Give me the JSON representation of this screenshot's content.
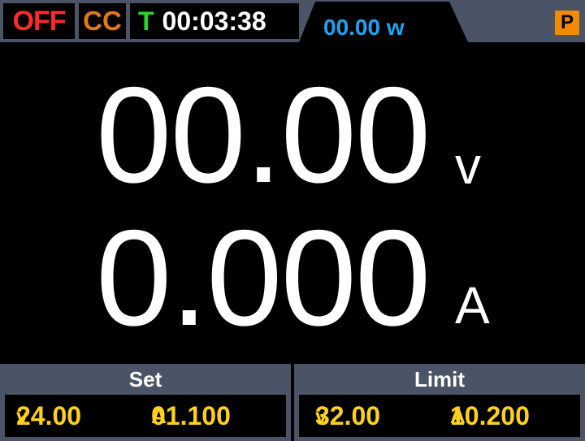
{
  "status": {
    "output": "OFF",
    "mode": "CC",
    "timer_icon": "T",
    "timer": "00:03:38",
    "power_value": "00.00",
    "power_unit": "w",
    "badge": "P"
  },
  "readout": {
    "voltage": "00.00",
    "voltage_unit": "v",
    "current": "0.000",
    "current_unit": "A"
  },
  "set_panel": {
    "title": "Set",
    "voltage": "24.00",
    "voltage_unit": "v",
    "current": "01.100",
    "current_unit": "A"
  },
  "limit_panel": {
    "title": "Limit",
    "voltage": "32.00",
    "voltage_unit": "v",
    "current": "10.200",
    "current_unit": "A"
  },
  "colors": {
    "output_off": "#ff2a2a",
    "mode": "#e0791d",
    "timer_icon": "#2ed42e",
    "power": "#1fa3f0",
    "badge": "#f08a00",
    "setting_values": "#ffd21a",
    "bar": "#4a5466"
  }
}
